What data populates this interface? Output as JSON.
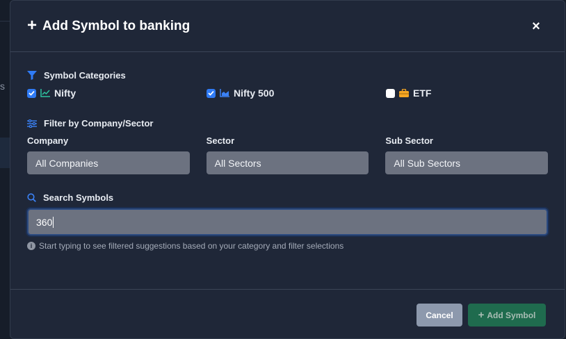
{
  "backdrop": {
    "fragment_text": "s"
  },
  "modal": {
    "title": "Add Symbol to banking",
    "close_label": "×"
  },
  "categories": {
    "label": "Symbol Categories",
    "items": [
      {
        "label": "Nifty",
        "checked": true,
        "icon": "line-chart-icon",
        "icon_color": "#2ec4a0"
      },
      {
        "label": "Nifty 500",
        "checked": true,
        "icon": "area-chart-icon",
        "icon_color": "#3b82f6"
      },
      {
        "label": "ETF",
        "checked": false,
        "icon": "briefcase-icon",
        "icon_color": "#f5a623"
      }
    ]
  },
  "filter": {
    "label": "Filter by Company/Sector",
    "company": {
      "label": "Company",
      "value": "All Companies"
    },
    "sector": {
      "label": "Sector",
      "value": "All Sectors"
    },
    "sub_sector": {
      "label": "Sub Sector",
      "value": "All Sub Sectors"
    }
  },
  "search": {
    "label": "Search Symbols",
    "value": "360",
    "hint": "Start typing to see filtered suggestions based on your category and filter selections"
  },
  "footer": {
    "cancel_label": "Cancel",
    "add_label": "Add Symbol"
  },
  "colors": {
    "accent": "#2f7bf6",
    "modal_bg": "#1f2738",
    "add_button": "#1f6b4e",
    "cancel_button": "#8d99ad"
  }
}
